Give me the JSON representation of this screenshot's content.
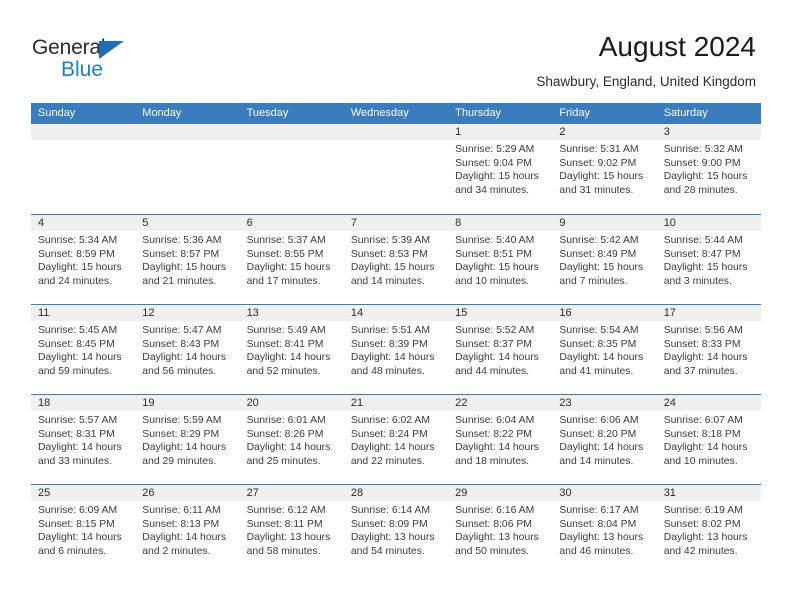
{
  "brand": {
    "name_dark": "General",
    "name_blue": "Blue",
    "accent_blue": "#1d7fd0",
    "triangle_blue": "#1d6fb8"
  },
  "header": {
    "title": "August 2024",
    "subtitle": "Shawbury, England, United Kingdom",
    "header_bg": "#3a7cbe",
    "band_bg": "#f0f0f0"
  },
  "weekdays": [
    "Sunday",
    "Monday",
    "Tuesday",
    "Wednesday",
    "Thursday",
    "Friday",
    "Saturday"
  ],
  "weeks": [
    [
      {
        "day": "",
        "lines": []
      },
      {
        "day": "",
        "lines": []
      },
      {
        "day": "",
        "lines": []
      },
      {
        "day": "",
        "lines": []
      },
      {
        "day": "1",
        "lines": [
          "Sunrise: 5:29 AM",
          "Sunset: 9:04 PM",
          "Daylight: 15 hours",
          "and 34 minutes."
        ]
      },
      {
        "day": "2",
        "lines": [
          "Sunrise: 5:31 AM",
          "Sunset: 9:02 PM",
          "Daylight: 15 hours",
          "and 31 minutes."
        ]
      },
      {
        "day": "3",
        "lines": [
          "Sunrise: 5:32 AM",
          "Sunset: 9:00 PM",
          "Daylight: 15 hours",
          "and 28 minutes."
        ]
      }
    ],
    [
      {
        "day": "4",
        "lines": [
          "Sunrise: 5:34 AM",
          "Sunset: 8:59 PM",
          "Daylight: 15 hours",
          "and 24 minutes."
        ]
      },
      {
        "day": "5",
        "lines": [
          "Sunrise: 5:36 AM",
          "Sunset: 8:57 PM",
          "Daylight: 15 hours",
          "and 21 minutes."
        ]
      },
      {
        "day": "6",
        "lines": [
          "Sunrise: 5:37 AM",
          "Sunset: 8:55 PM",
          "Daylight: 15 hours",
          "and 17 minutes."
        ]
      },
      {
        "day": "7",
        "lines": [
          "Sunrise: 5:39 AM",
          "Sunset: 8:53 PM",
          "Daylight: 15 hours",
          "and 14 minutes."
        ]
      },
      {
        "day": "8",
        "lines": [
          "Sunrise: 5:40 AM",
          "Sunset: 8:51 PM",
          "Daylight: 15 hours",
          "and 10 minutes."
        ]
      },
      {
        "day": "9",
        "lines": [
          "Sunrise: 5:42 AM",
          "Sunset: 8:49 PM",
          "Daylight: 15 hours",
          "and 7 minutes."
        ]
      },
      {
        "day": "10",
        "lines": [
          "Sunrise: 5:44 AM",
          "Sunset: 8:47 PM",
          "Daylight: 15 hours",
          "and 3 minutes."
        ]
      }
    ],
    [
      {
        "day": "11",
        "lines": [
          "Sunrise: 5:45 AM",
          "Sunset: 8:45 PM",
          "Daylight: 14 hours",
          "and 59 minutes."
        ]
      },
      {
        "day": "12",
        "lines": [
          "Sunrise: 5:47 AM",
          "Sunset: 8:43 PM",
          "Daylight: 14 hours",
          "and 56 minutes."
        ]
      },
      {
        "day": "13",
        "lines": [
          "Sunrise: 5:49 AM",
          "Sunset: 8:41 PM",
          "Daylight: 14 hours",
          "and 52 minutes."
        ]
      },
      {
        "day": "14",
        "lines": [
          "Sunrise: 5:51 AM",
          "Sunset: 8:39 PM",
          "Daylight: 14 hours",
          "and 48 minutes."
        ]
      },
      {
        "day": "15",
        "lines": [
          "Sunrise: 5:52 AM",
          "Sunset: 8:37 PM",
          "Daylight: 14 hours",
          "and 44 minutes."
        ]
      },
      {
        "day": "16",
        "lines": [
          "Sunrise: 5:54 AM",
          "Sunset: 8:35 PM",
          "Daylight: 14 hours",
          "and 41 minutes."
        ]
      },
      {
        "day": "17",
        "lines": [
          "Sunrise: 5:56 AM",
          "Sunset: 8:33 PM",
          "Daylight: 14 hours",
          "and 37 minutes."
        ]
      }
    ],
    [
      {
        "day": "18",
        "lines": [
          "Sunrise: 5:57 AM",
          "Sunset: 8:31 PM",
          "Daylight: 14 hours",
          "and 33 minutes."
        ]
      },
      {
        "day": "19",
        "lines": [
          "Sunrise: 5:59 AM",
          "Sunset: 8:29 PM",
          "Daylight: 14 hours",
          "and 29 minutes."
        ]
      },
      {
        "day": "20",
        "lines": [
          "Sunrise: 6:01 AM",
          "Sunset: 8:26 PM",
          "Daylight: 14 hours",
          "and 25 minutes."
        ]
      },
      {
        "day": "21",
        "lines": [
          "Sunrise: 6:02 AM",
          "Sunset: 8:24 PM",
          "Daylight: 14 hours",
          "and 22 minutes."
        ]
      },
      {
        "day": "22",
        "lines": [
          "Sunrise: 6:04 AM",
          "Sunset: 8:22 PM",
          "Daylight: 14 hours",
          "and 18 minutes."
        ]
      },
      {
        "day": "23",
        "lines": [
          "Sunrise: 6:06 AM",
          "Sunset: 8:20 PM",
          "Daylight: 14 hours",
          "and 14 minutes."
        ]
      },
      {
        "day": "24",
        "lines": [
          "Sunrise: 6:07 AM",
          "Sunset: 8:18 PM",
          "Daylight: 14 hours",
          "and 10 minutes."
        ]
      }
    ],
    [
      {
        "day": "25",
        "lines": [
          "Sunrise: 6:09 AM",
          "Sunset: 8:15 PM",
          "Daylight: 14 hours",
          "and 6 minutes."
        ]
      },
      {
        "day": "26",
        "lines": [
          "Sunrise: 6:11 AM",
          "Sunset: 8:13 PM",
          "Daylight: 14 hours",
          "and 2 minutes."
        ]
      },
      {
        "day": "27",
        "lines": [
          "Sunrise: 6:12 AM",
          "Sunset: 8:11 PM",
          "Daylight: 13 hours",
          "and 58 minutes."
        ]
      },
      {
        "day": "28",
        "lines": [
          "Sunrise: 6:14 AM",
          "Sunset: 8:09 PM",
          "Daylight: 13 hours",
          "and 54 minutes."
        ]
      },
      {
        "day": "29",
        "lines": [
          "Sunrise: 6:16 AM",
          "Sunset: 8:06 PM",
          "Daylight: 13 hours",
          "and 50 minutes."
        ]
      },
      {
        "day": "30",
        "lines": [
          "Sunrise: 6:17 AM",
          "Sunset: 8:04 PM",
          "Daylight: 13 hours",
          "and 46 minutes."
        ]
      },
      {
        "day": "31",
        "lines": [
          "Sunrise: 6:19 AM",
          "Sunset: 8:02 PM",
          "Daylight: 13 hours",
          "and 42 minutes."
        ]
      }
    ]
  ]
}
